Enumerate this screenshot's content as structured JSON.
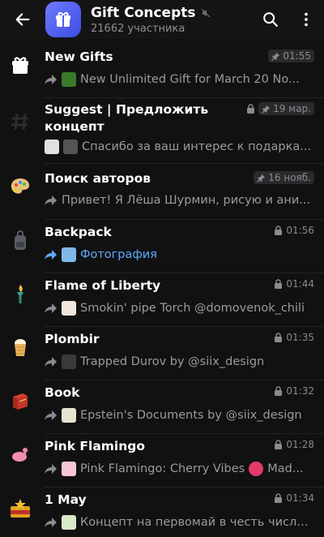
{
  "header": {
    "title": "Gift Concepts",
    "subtitle": "21662 участника",
    "accent": "#5b6bff"
  },
  "chats": [
    {
      "name": "New Gifts",
      "time": "01:55",
      "pinned": true,
      "preview": "New Unlimited Gift for March 20 No...",
      "preview_color": "#9b9ba0",
      "icon": "gift-icon"
    },
    {
      "name": "Suggest | Предложить концепт",
      "time": "19 мар.",
      "pinned": true,
      "locked": true,
      "preview": "Спасибо за ваш интерес к подарка...",
      "icon": "hash-icon"
    },
    {
      "name": "Поиск авторов",
      "time": "16 нояб.",
      "pinned": true,
      "preview": "Привет! Я Лёша Шурмин, рисую и ани...",
      "icon": "palette-icon"
    },
    {
      "name": "Backpack",
      "time": "01:56",
      "locked": true,
      "preview": "Фотография",
      "preview_color": "#5ea9ff",
      "icon": "backpack-icon"
    },
    {
      "name": "Flame of Liberty",
      "time": "01:44",
      "locked": true,
      "preview": "Smokin' pipe Torch @domovenok_chili",
      "icon": "torch-icon"
    },
    {
      "name": "Plombir",
      "time": "01:35",
      "locked": true,
      "preview": "Trapped Durov  by @siix_design",
      "icon": "ice-cream-icon"
    },
    {
      "name": "Book",
      "time": "01:32",
      "locked": true,
      "preview": "Epstein's Documents  by @siix_design",
      "icon": "book-icon"
    },
    {
      "name": "Pink Flamingo",
      "time": "01:28",
      "locked": true,
      "preview": "Pink Flamingo: Cherry Vibes",
      "preview_tail": "Mad...",
      "icon": "flamingo-icon"
    },
    {
      "name": "1 May",
      "time": "01:34",
      "locked": true,
      "preview": "Концепт на первомай в честь числа...",
      "icon": "may-day-icon"
    }
  ]
}
